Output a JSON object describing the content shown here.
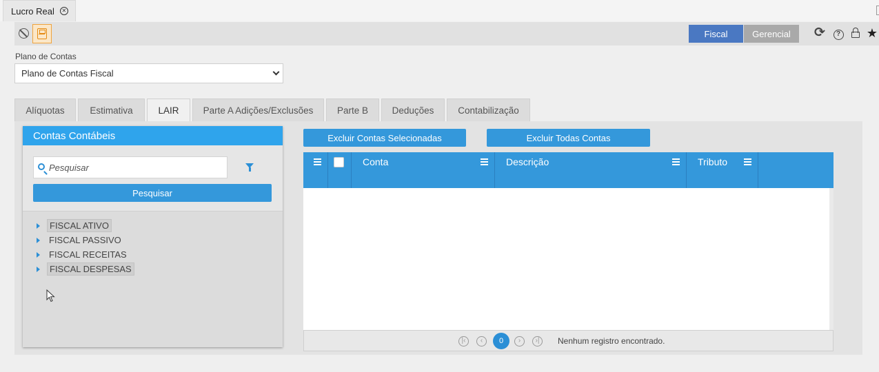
{
  "window_tab": {
    "label": "Lucro Real"
  },
  "toolbar": {
    "fiscal_label": "Fiscal",
    "gerencial_label": "Gerencial"
  },
  "plano": {
    "label": "Plano de Contas",
    "selected": "Plano de Contas Fiscal"
  },
  "tabs": [
    "Alíquotas",
    "Estimativa",
    "LAIR",
    "Parte A Adições/Exclusões",
    "Parte B",
    "Deduções",
    "Contabilização"
  ],
  "active_tab": "LAIR",
  "left_panel": {
    "title": "Contas Contábeis",
    "search_placeholder": "Pesquisar",
    "search_button": "Pesquisar",
    "tree": [
      "FISCAL ATIVO",
      "FISCAL PASSIVO",
      "FISCAL RECEITAS",
      "FISCAL DESPESAS"
    ]
  },
  "actions": {
    "delete_selected": "Excluir Contas Selecionadas",
    "delete_all": "Excluir Todas Contas"
  },
  "grid": {
    "columns": [
      "Conta",
      "Descrição",
      "Tributo"
    ]
  },
  "pager": {
    "page": "0",
    "status": "Nenhum registro encontrado."
  },
  "colors": {
    "accent": "#3498db",
    "header_blue": "#2fa4ec",
    "fiscal_active": "#4a78c2",
    "save_orange": "#e58b13"
  }
}
